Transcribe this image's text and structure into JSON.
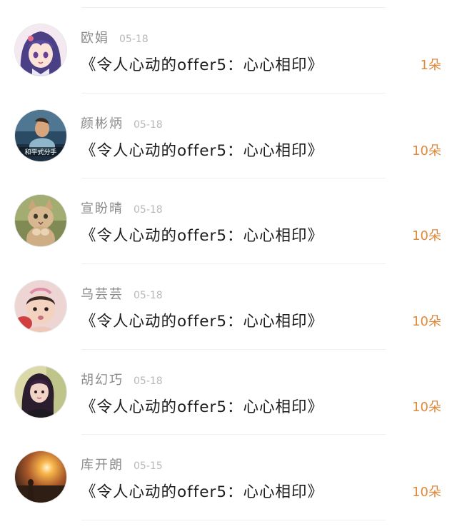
{
  "items": [
    {
      "name": "欧娟",
      "date": "05-18",
      "title": "《令人心动的offer5：心心相印》",
      "count": "1朵",
      "avatar": "anime-girl-avatar"
    },
    {
      "name": "颜彬炳",
      "date": "05-18",
      "title": "《令人心动的offer5：心心相印》",
      "count": "10朵",
      "avatar": "game-character-avatar",
      "avatar_text": "和平式分手"
    },
    {
      "name": "宣盼晴",
      "date": "05-18",
      "title": "《令人心动的offer5：心心相印》",
      "count": "10朵",
      "avatar": "cat-avatar"
    },
    {
      "name": "乌芸芸",
      "date": "05-18",
      "title": "《令人心动的offer5：心心相印》",
      "count": "10朵",
      "avatar": "baby-avatar"
    },
    {
      "name": "胡幻巧",
      "date": "05-18",
      "title": "《令人心动的offer5：心心相印》",
      "count": "10朵",
      "avatar": "girl-portrait-avatar"
    },
    {
      "name": "库开朗",
      "date": "05-15",
      "title": "《令人心动的offer5：心心相印》",
      "count": "10朵",
      "avatar": "sunset-avatar"
    }
  ],
  "colors": {
    "name": "#8a8a8a",
    "date": "#b8b8b8",
    "title": "#1c1c1c",
    "count": "#e0893a",
    "divider": "#efefef"
  }
}
